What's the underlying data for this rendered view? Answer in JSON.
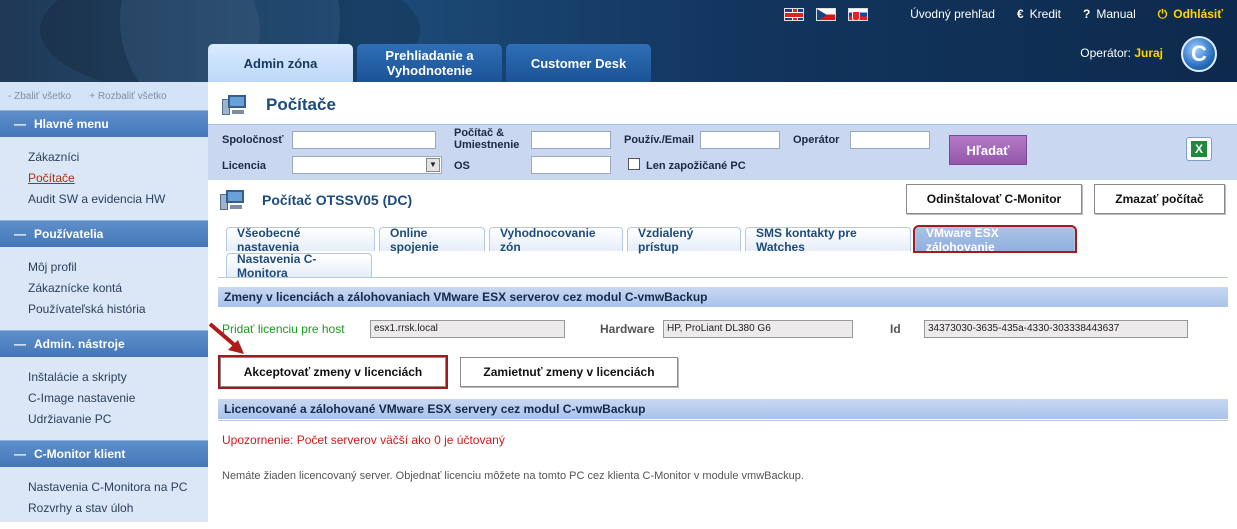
{
  "header": {
    "flags": [
      "flag-uk",
      "flag-cz",
      "flag-sk"
    ],
    "nav": {
      "home": "Úvodný prehľad",
      "credit": "Kredit",
      "manual": "Manual",
      "logout": "Odhlásiť"
    },
    "tabs": [
      {
        "label": "Admin zóna"
      },
      {
        "label_line1": "Prehliadanie a",
        "label_line2": "Vyhodnotenie"
      },
      {
        "label": "Customer Desk"
      }
    ],
    "operator_label": "Operátor:",
    "operator_name": "Juraj",
    "logo_letter": "C"
  },
  "sidebar": {
    "collapse_all": "- Zbaliť všetko",
    "expand_all": "+ Rozbaliť všetko",
    "sections": [
      {
        "title": "Hlavné menu",
        "items": [
          "Zákazníci",
          "Počítače",
          "Audit SW a evidencia HW"
        ]
      },
      {
        "title": "Používatelia",
        "items": [
          "Môj profil",
          "Zákaznícke kontá",
          "Používateľská história"
        ]
      },
      {
        "title": "Admin. nástroje",
        "items": [
          "Inštalácie a skripty",
          "C-Image nastavenie",
          "Udržiavanie PC"
        ]
      },
      {
        "title": "C-Monitor klient",
        "items": [
          "Nastavenia C-Monitora na PC",
          "Rozvrhy a stav úloh"
        ]
      }
    ],
    "current_item": "Počítače"
  },
  "page": {
    "title": "Počítače",
    "filters": {
      "company": "Spoločnosť",
      "computer_line1": "Počítač &",
      "computer_line2": "Umiestnenie",
      "user": "Použív./Email",
      "operator": "Operátor",
      "license": "Licencia",
      "os": "OS",
      "borrowed": "Len zapožičané PC",
      "search": "Hľadať"
    },
    "computer_title": "Počítač OTSSV05 (DC)",
    "uninstall_btn": "Odinštalovať C-Monitor",
    "delete_btn": "Zmazať počítač",
    "subtabs": [
      "Všeobecné nastavenia",
      "Online spojenie",
      "Vyhodnocovanie zón",
      "Vzdialený prístup",
      "SMS kontakty pre Watches",
      "VMware ESX zálohovanie",
      "Nastavenia C-Monitora"
    ],
    "active_subtab": "VMware ESX zálohovanie",
    "section1": "Zmeny v licenciách a zálohovaniach VMware ESX serverov cez modul C-vmwBackup",
    "add_license_label": "Pridať licenciu pre host",
    "host_value": "esx1.rrsk.local",
    "hardware_label": "Hardware",
    "hardware_value": "HP, ProLiant DL380 G6",
    "id_label": "Id",
    "id_value": "34373030-3635-435a-4330-303338443637",
    "accept_btn": "Akceptovať zmeny v licenciách",
    "reject_btn": "Zamietnuť zmeny v licenciách",
    "section2": "Licencované a zálohované VMware ESX servery cez modul C-vmwBackup",
    "warning": "Upozornenie: Počet serverov väčší ako 0 je účtovaný",
    "note": "Nemáte žiaden licencovaný server. Objednať licenciu môžete na tomto PC cez klienta C-Monitor v module vmwBackup."
  },
  "colors": {
    "accent_red": "#a01c1c",
    "header_blue": "#173f66",
    "sidebar_head": "#4476b8",
    "warning": "#d11a1a",
    "link_green": "#1a9a1a"
  }
}
